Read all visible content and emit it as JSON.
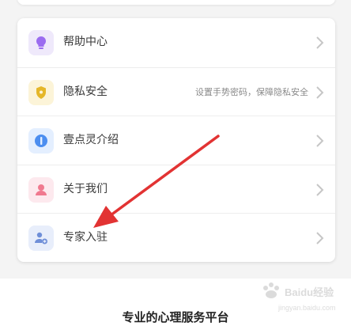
{
  "menu": {
    "items": [
      {
        "label": "帮助中心",
        "hint": "",
        "icon": "lightbulb-icon",
        "icon_bg": "#efe9fb",
        "icon_color": "#9b6cf0"
      },
      {
        "label": "隐私安全",
        "hint": "设置手势密码，保障隐私安全",
        "icon": "shield-icon",
        "icon_bg": "#fcf4d8",
        "icon_color": "#e5b728"
      },
      {
        "label": "壹点灵介绍",
        "hint": "",
        "icon": "info-icon",
        "icon_bg": "#e4efff",
        "icon_color": "#4c8ef0"
      },
      {
        "label": "关于我们",
        "hint": "",
        "icon": "person-icon",
        "icon_bg": "#fde9ee",
        "icon_color": "#f0798f"
      },
      {
        "label": "专家入驻",
        "hint": "",
        "icon": "user-add-icon",
        "icon_bg": "#e8eefb",
        "icon_color": "#6f8fd8"
      }
    ]
  },
  "footer": {
    "slogan": "专业的心理服务平台"
  },
  "watermark": {
    "brand": "Baidu经验",
    "url": "jingyan.baidu.com"
  },
  "colors": {
    "arrow": "#e23333",
    "chevron": "#c6c6c6"
  }
}
